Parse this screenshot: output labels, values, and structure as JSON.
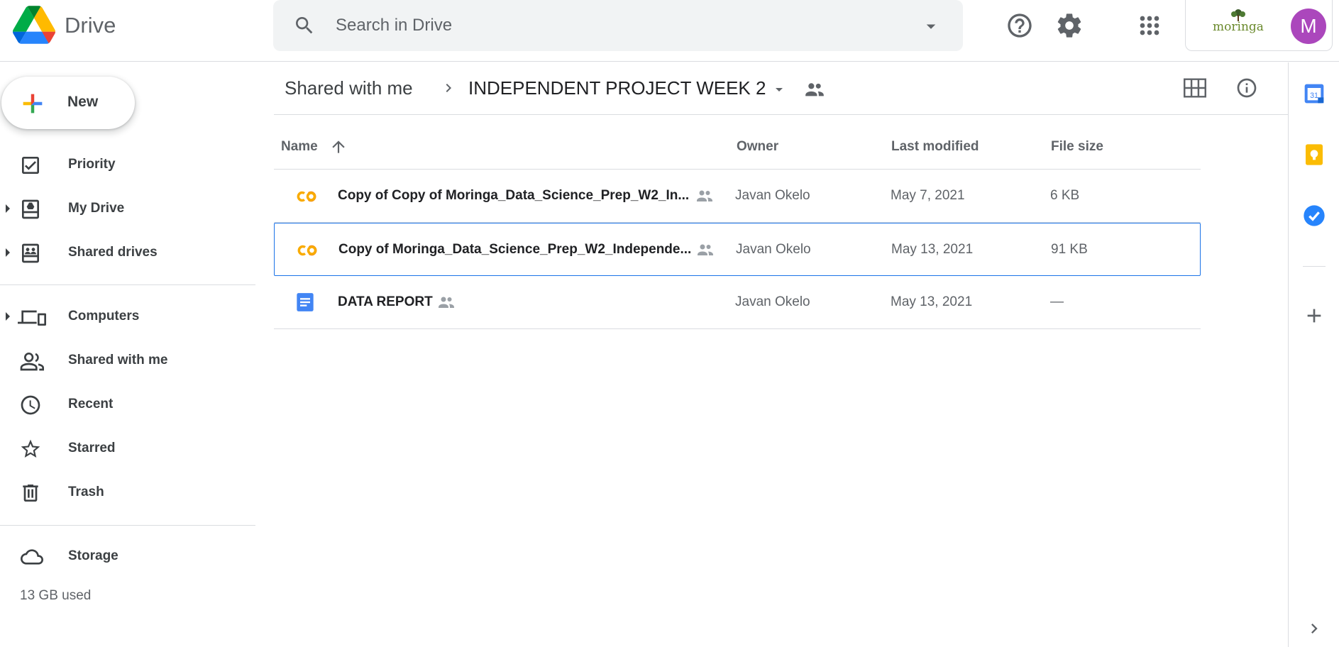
{
  "app": {
    "title": "Drive"
  },
  "search": {
    "placeholder": "Search in Drive",
    "value": ""
  },
  "account": {
    "org_name": "moringa",
    "avatar_letter": "M",
    "avatar_color": "#ab47bc"
  },
  "sidebar": {
    "new_label": "New",
    "items": [
      {
        "label": "Priority",
        "icon": "priority-icon"
      },
      {
        "label": "My Drive",
        "icon": "my-drive-icon"
      },
      {
        "label": "Shared drives",
        "icon": "shared-drives-icon"
      },
      {
        "label": "Computers",
        "icon": "computers-icon"
      },
      {
        "label": "Shared with me",
        "icon": "shared-with-me-icon"
      },
      {
        "label": "Recent",
        "icon": "clock-icon"
      },
      {
        "label": "Starred",
        "icon": "star-icon"
      },
      {
        "label": "Trash",
        "icon": "trash-icon"
      },
      {
        "label": "Storage",
        "icon": "cloud-icon"
      }
    ],
    "storage_used": "13 GB used"
  },
  "breadcrumb": {
    "root": "Shared with me",
    "current": "INDEPENDENT PROJECT WEEK 2"
  },
  "table": {
    "headers": {
      "name": "Name",
      "owner": "Owner",
      "modified": "Last modified",
      "size": "File size"
    },
    "rows": [
      {
        "name": "Copy of Copy of Moringa_Data_Science_Prep_W2_In...",
        "type": "colab",
        "owner": "Javan Okelo",
        "modified": "May 7, 2021",
        "size": "6 KB",
        "selected": false
      },
      {
        "name": "Copy of Moringa_Data_Science_Prep_W2_Independe...",
        "type": "colab",
        "owner": "Javan Okelo",
        "modified": "May 13, 2021",
        "size": "91 KB",
        "selected": true
      },
      {
        "name": "DATA REPORT",
        "type": "docs",
        "owner": "Javan Okelo",
        "modified": "May 13, 2021",
        "size": "—",
        "selected": false
      }
    ]
  },
  "colors": {
    "accent": "#1a73e8",
    "colab": "#f9ab00",
    "docs": "#4285f4"
  }
}
